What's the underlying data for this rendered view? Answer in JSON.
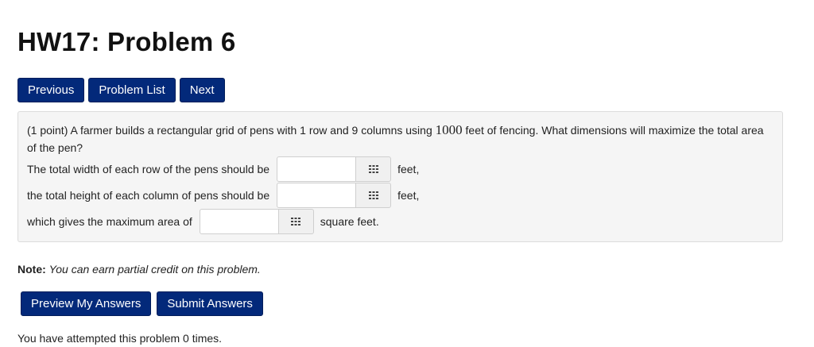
{
  "title": "HW17: Problem 6",
  "nav": {
    "previous": "Previous",
    "problem_list": "Problem List",
    "next": "Next"
  },
  "problem": {
    "points": "(1 point)",
    "text_before": "A farmer builds a rectangular grid of pens with 1 row and 9 columns using",
    "fencing": "1000",
    "text_after": "feet of fencing. What dimensions will maximize the total area of the pen?",
    "answers": [
      {
        "label": "The total width of each row of the pens should be",
        "value": "",
        "unit": "feet,"
      },
      {
        "label": "the total height of each column of pens should be",
        "value": "",
        "unit": "feet,"
      },
      {
        "label": "which gives the maximum area of",
        "value": "",
        "unit": "square feet."
      }
    ]
  },
  "note": {
    "bold": "Note:",
    "text": "You can earn partial credit on this problem."
  },
  "submit": {
    "preview": "Preview My Answers",
    "submit": "Submit Answers"
  },
  "attempts": "You have attempted this problem 0 times.",
  "colors": {
    "button_bg": "#03297a",
    "box_bg": "#f5f5f5"
  }
}
